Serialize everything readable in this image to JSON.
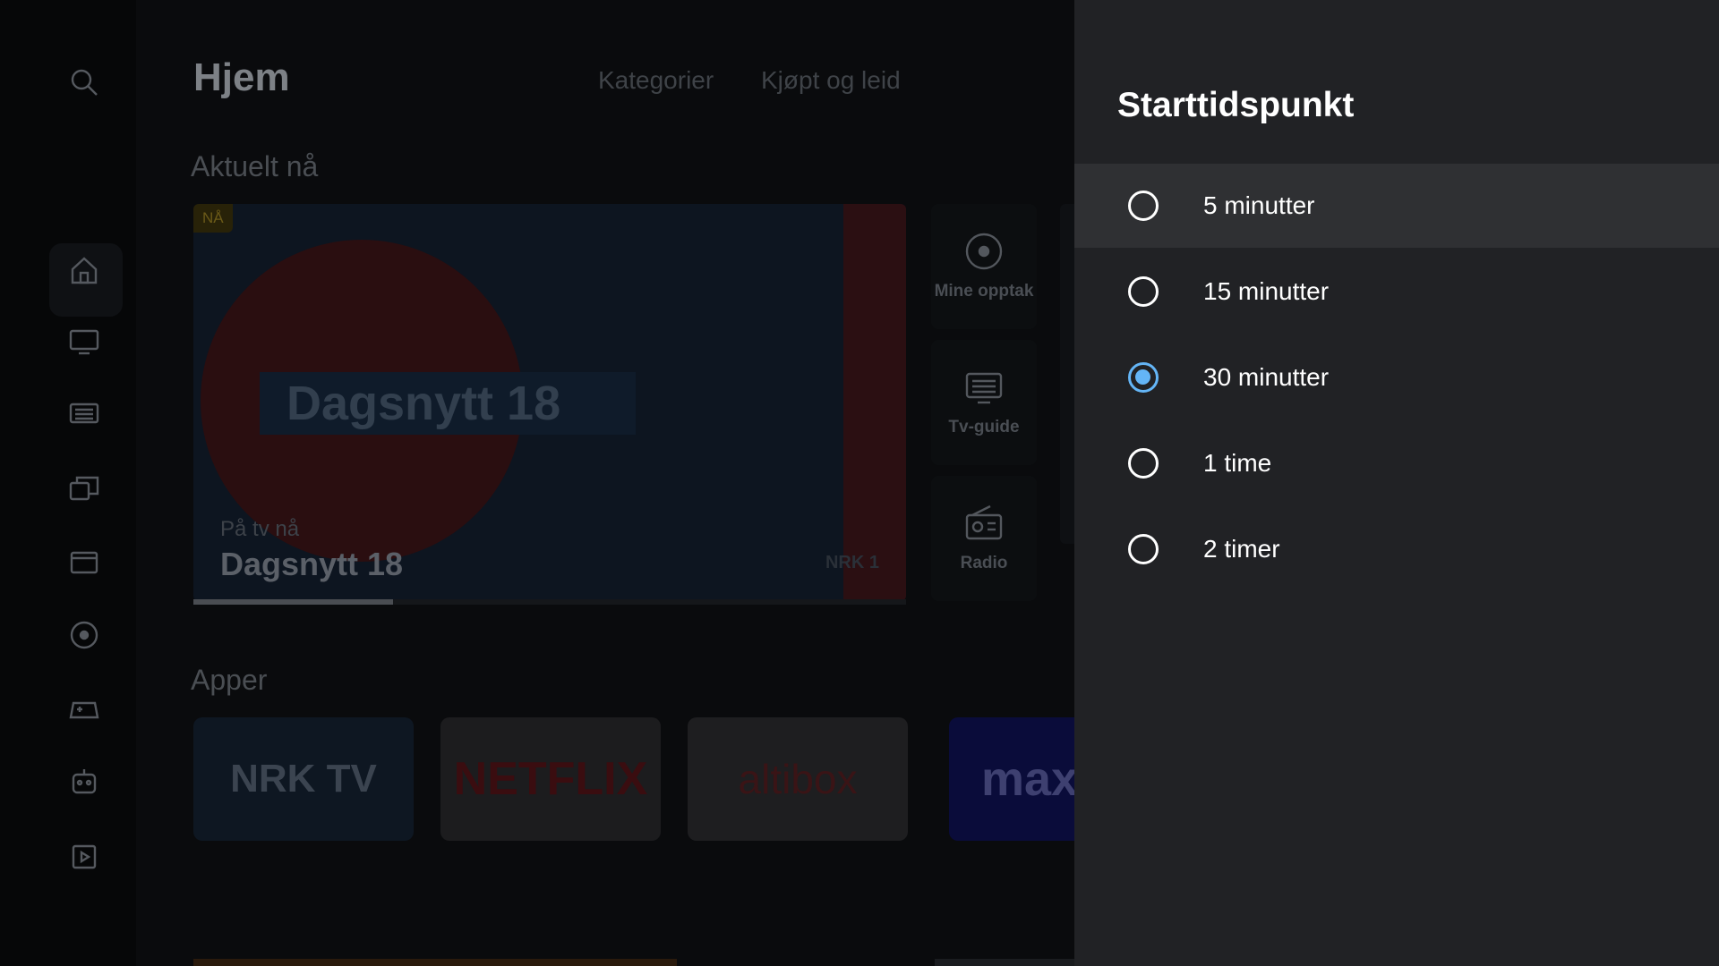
{
  "header": {
    "title": "Hjem",
    "tabs": [
      "Kategorier",
      "Kjøpt og leid"
    ]
  },
  "rail": {
    "icons": [
      "search-icon",
      "home-icon",
      "tv-icon",
      "guide-icon",
      "library-icon",
      "movie-icon",
      "record-icon",
      "game-icon",
      "kids-icon",
      "play-store-icon"
    ]
  },
  "sections": {
    "current": "Aktuelt nå",
    "apps": "Apper"
  },
  "hero": {
    "badge": "NÅ",
    "overlay_title": "Dagsnytt 18",
    "subtitle": "På tv nå",
    "program": "Dagsnytt 18",
    "channel_logo": "NRK 1",
    "progress": 0.28
  },
  "side_tiles": [
    {
      "label": "Mine opptak",
      "icon": "record-icon"
    },
    {
      "label": "Tv-guide",
      "icon": "guide-icon"
    },
    {
      "label": "Radio",
      "icon": "radio-icon"
    }
  ],
  "apps": [
    {
      "label": "NRK TV",
      "bg": "#0e1722",
      "fg": "#3b4450"
    },
    {
      "label": "NETFLIX",
      "bg": "#1c1c1e",
      "fg": "#3a0d10"
    },
    {
      "label": "altibox",
      "bg": "#1e1e20",
      "fg": "#3a1416"
    },
    {
      "label": "max",
      "bg": "#0a0c3a",
      "fg": "#3e4070"
    }
  ],
  "panel": {
    "title": "Starttidspunkt",
    "options": [
      {
        "label": "5 minutter",
        "checked": false,
        "focused": true
      },
      {
        "label": "15 minutter",
        "checked": false,
        "focused": false
      },
      {
        "label": "30 minutter",
        "checked": true,
        "focused": false
      },
      {
        "label": "1 time",
        "checked": false,
        "focused": false
      },
      {
        "label": "2 timer",
        "checked": false,
        "focused": false
      }
    ]
  },
  "colors": {
    "panel_bg": "#212225",
    "focus_bg": "#2f3033",
    "accent": "#64b5f6"
  }
}
